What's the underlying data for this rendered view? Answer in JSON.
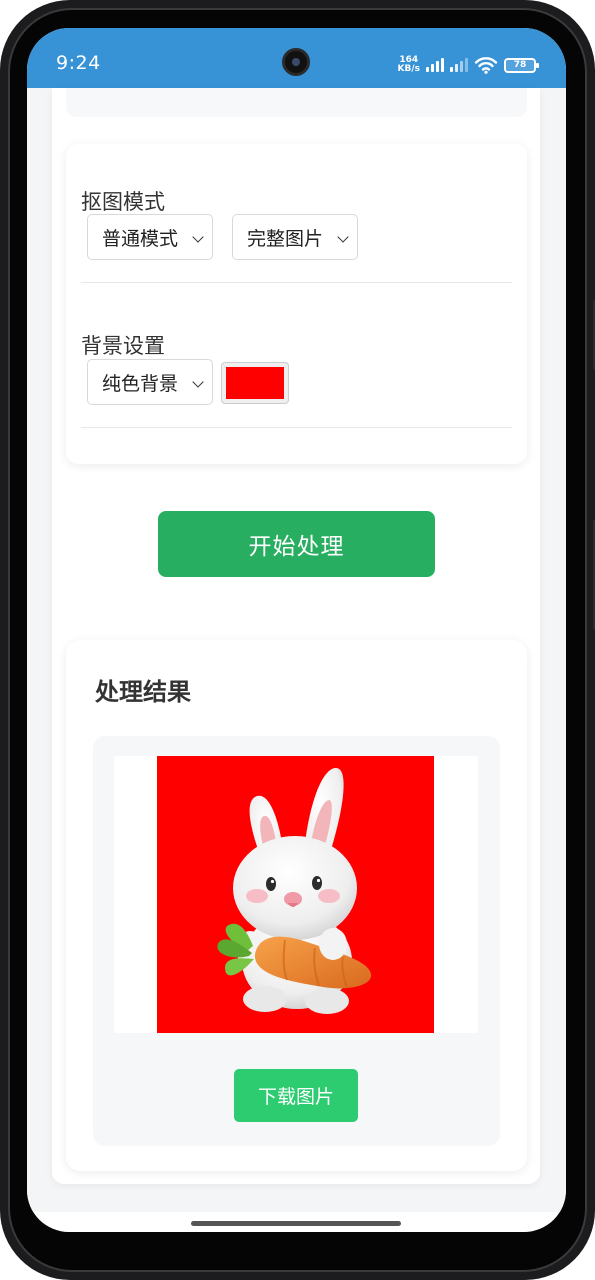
{
  "status_bar": {
    "time": "9:24",
    "net_speed_value": "164",
    "net_speed_unit": "KB/s",
    "battery_level": "78",
    "bar_color": "#3893d6",
    "icons": [
      "camera-icon",
      "signal-icon",
      "wifi-icon",
      "battery-icon"
    ]
  },
  "settings": {
    "matting_mode": {
      "label": "抠图模式",
      "mode_select": "普通模式",
      "output_select": "完整图片"
    },
    "background": {
      "label": "背景设置",
      "type_select": "纯色背景",
      "color": "#ff0000"
    }
  },
  "actions": {
    "start_label": "开始处理",
    "start_color": "#27ae60"
  },
  "result": {
    "title": "处理结果",
    "image_background": "#ff0000",
    "image_subject": "rabbit-holding-carrot",
    "download_label": "下载图片",
    "download_color": "#2ecc71"
  }
}
